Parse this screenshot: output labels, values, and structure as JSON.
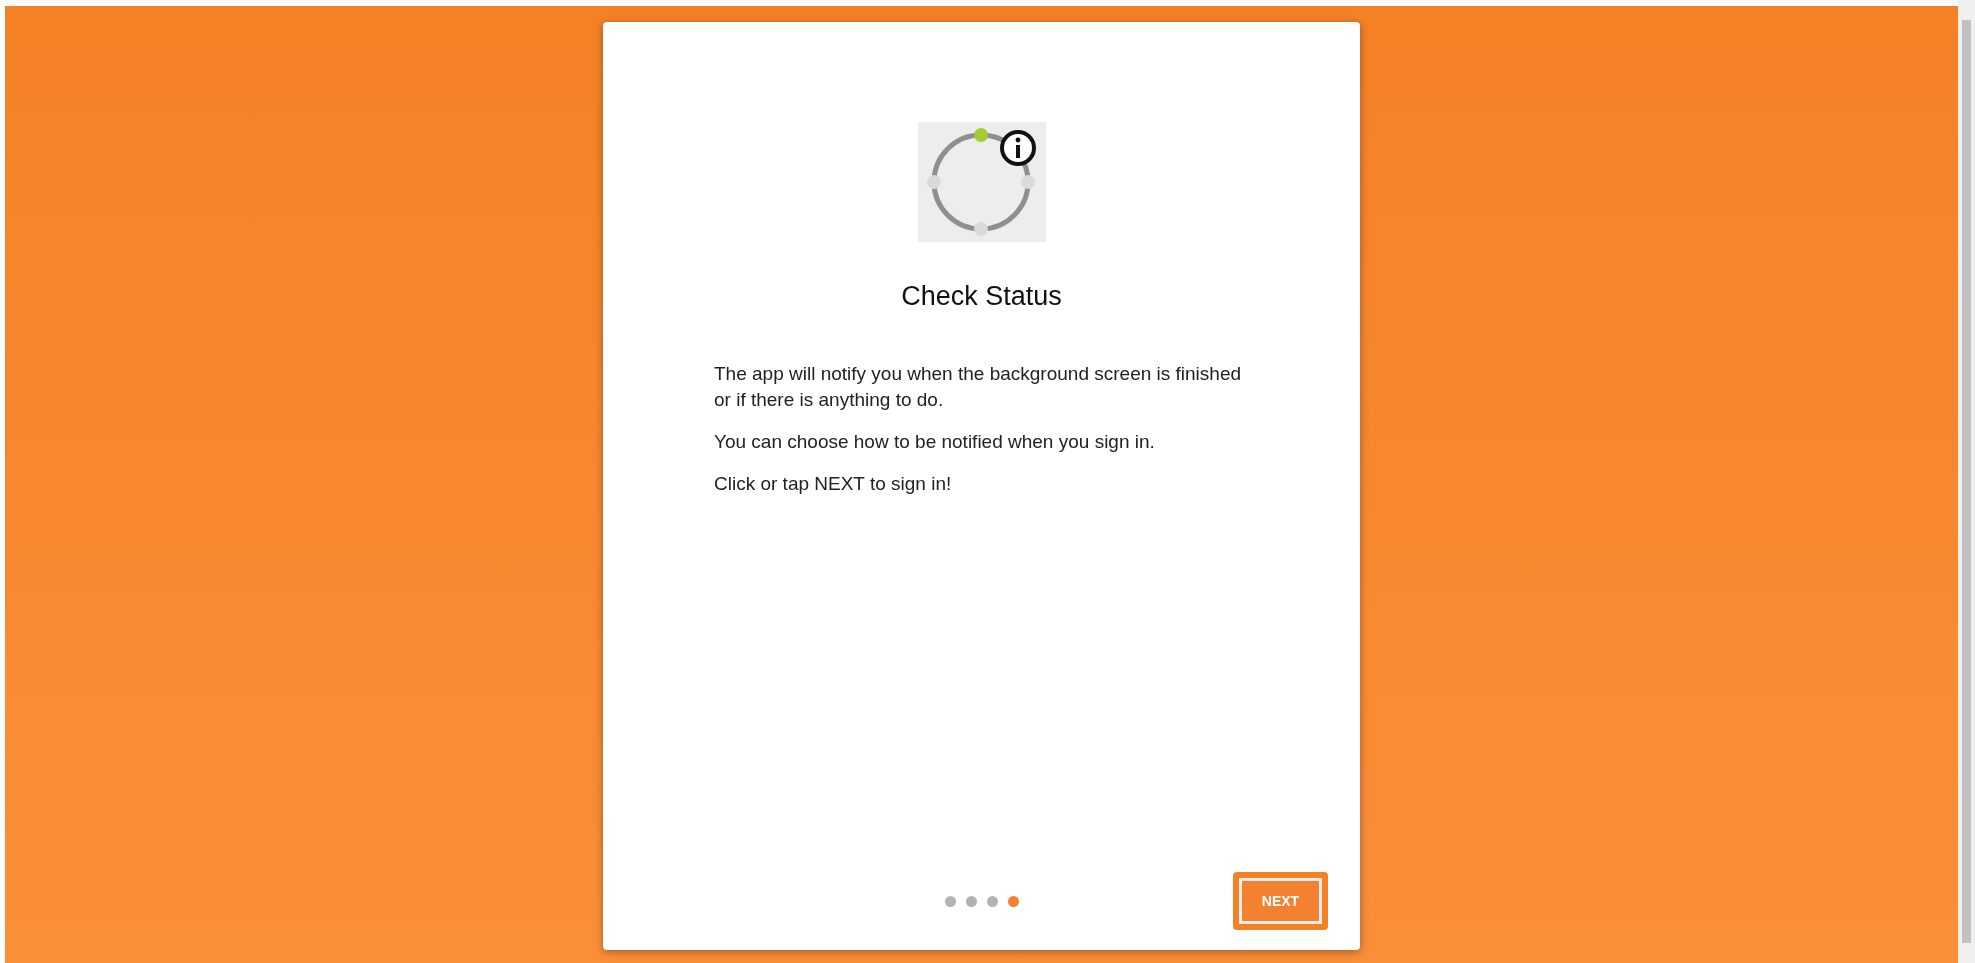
{
  "dialog": {
    "title": "Check Status",
    "paragraphs": [
      "The app will notify you when the background screen is finished or if there is anything to do.",
      "You can choose how to be notified when you sign in.",
      "Click or tap NEXT to sign in!"
    ],
    "pager": [
      {
        "selected": false
      },
      {
        "selected": false
      },
      {
        "selected": false
      },
      {
        "selected": true
      }
    ],
    "next_button": {
      "label": "NEXT",
      "focused": true
    }
  }
}
